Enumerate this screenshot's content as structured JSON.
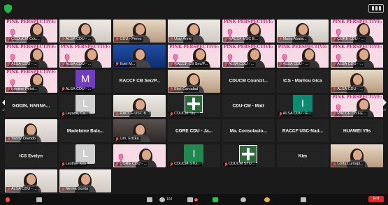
{
  "pager": {
    "left_num": "1/2",
    "right_num": "1/2"
  },
  "tiles": [
    {
      "name": "tile-ccducm-cou",
      "label": "CCDUCM Cou...",
      "kind": "pink",
      "header": "PINK PERSPECTIVE:"
    },
    {
      "name": "tile-alsa-cdu-1",
      "label": "ALSA CDU - ...",
      "kind": "cam",
      "bg": "light"
    },
    {
      "name": "tile-cdu-perez",
      "label": "CDU - Perez",
      "kind": "cam",
      "bg": "warm"
    },
    {
      "name": "tile-ujayanne",
      "label": "Ujay Anne",
      "kind": "cam",
      "bg": "light"
    },
    {
      "name": "tile-raccf-usc",
      "label": "RACCF-USC E...",
      "kind": "pink",
      "header": "PINK PERSPECTIVE:"
    },
    {
      "name": "tile-maria-abata",
      "label": "Maria Abata...",
      "kind": "cam",
      "bg": "light"
    },
    {
      "name": "tile-core-cdu-1",
      "label": "CORE CDU - ...",
      "kind": "pink",
      "header": "PINK PERSPECTIVE:"
    },
    {
      "name": "tile-alsa-cdu-2",
      "label": "ALSA CDU - ...",
      "kind": "pink",
      "header": "PINK PERSPECTIVE:"
    },
    {
      "name": "tile-alsa-cdu-3",
      "label": "ALSA CDU - ...",
      "kind": "pink",
      "header": "PINK PERSPECTIVE:"
    },
    {
      "name": "tile-edel-m",
      "label": "Edel M...",
      "kind": "cam",
      "bg": "blue"
    },
    {
      "name": "tile-raccf-cb-sec-p",
      "label": "RACCF CB Sec/P...",
      "kind": "pink",
      "header": "PINK PERSPECTIVE:"
    },
    {
      "name": "tile-alsa-cdu-4",
      "label": "ALSA CDU - ...",
      "kind": "pink",
      "header": "PINK PERSPECTIVE:"
    },
    {
      "name": "tile-alsa-cdu-5",
      "label": "ALSA CDU - ...",
      "kind": "pink",
      "header": "PINK PERSPECTIVE:"
    },
    {
      "name": "tile-alsa-cdu-6",
      "label": "ALSA CDU - ...",
      "kind": "pink",
      "header": "PINK PERSPECTIVE:"
    },
    {
      "name": "tile-kristine-pelot",
      "label": "Kristine Pelot...",
      "kind": "pink",
      "header": "PINK PERSPECTIVE:"
    },
    {
      "name": "tile-alsa-cdu-7",
      "label": "ALSA CDU - ...",
      "kind": "avatar",
      "letter": "M",
      "av": "av-purple"
    },
    {
      "name": "tile-raccf-cb-sec-p-2",
      "center": "RACCF CB Sec/P...",
      "kind": "name"
    },
    {
      "name": "tile-eliel-carcabal",
      "label": "Eliel Carcabal",
      "kind": "cam",
      "bg": "warm"
    },
    {
      "name": "tile-cducm-council",
      "center": "CDUCM Council...",
      "kind": "name"
    },
    {
      "name": "tile-ics-marilou",
      "center": "ICS - Marilou Gica",
      "kind": "name"
    },
    {
      "name": "tile-alsa-cdu-8",
      "label": "ALSA CDU - ...",
      "kind": "cam",
      "bg": "warm"
    },
    {
      "name": "tile-godin-hanna",
      "center": "GODIN, HANNA...",
      "kind": "name"
    },
    {
      "name": "tile-leyada-ca",
      "label": "Leyada, Ca...",
      "kind": "avatar",
      "letter": "L",
      "av": "av-grey"
    },
    {
      "name": "tile-raccf-usc-b",
      "label": "RACCF-USC B...",
      "kind": "cam",
      "bg": "light"
    },
    {
      "name": "tile-cducm-stu-1",
      "label": "CDUCM Stu...",
      "kind": "logo"
    },
    {
      "name": "tile-cdu-cm-matt",
      "center": "CDU-CM - Matt",
      "kind": "name"
    },
    {
      "name": "tile-alsa-cdu-9",
      "label": "ALSA CDU - E...",
      "kind": "avatar",
      "letter": "I",
      "av": "av-teal"
    },
    {
      "name": "tile-raccf-cb-fe",
      "label": "RACCF CB FE...",
      "kind": "pink",
      "header": "PINK PERSPECTIVE:"
    },
    {
      "name": "tile-yanny-orendo",
      "label": "Yanny Orendo",
      "kind": "cam",
      "bg": "light"
    },
    {
      "name": "tile-madelaine-bala",
      "center": "Madelaine Bala...",
      "kind": "name"
    },
    {
      "name": "tile-lim-ericka",
      "label": "Lim, Ericka",
      "kind": "cam",
      "bg": "dark"
    },
    {
      "name": "tile-core-cdu-ja",
      "center": "CORE CDU - Ja...",
      "kind": "name"
    },
    {
      "name": "tile-ma-consolacion",
      "center": "Ma. Consolacio...",
      "kind": "name"
    },
    {
      "name": "tile-raccf-usc-nad",
      "center": "RACCF USC-Nad...",
      "kind": "name"
    },
    {
      "name": "tile-huawei-y9s",
      "center": "HUAWEI Y9s",
      "kind": "name"
    },
    {
      "name": "tile-ics-evelyn",
      "center": "ICS Evelyn",
      "kind": "name"
    },
    {
      "name": "tile-lesther-kim",
      "label": "Lesther Kim",
      "kind": "avatar",
      "letter": "L",
      "av": "av-grey"
    },
    {
      "name": "tile-core-cdu-2",
      "label": "CORE CDU - ...",
      "kind": "pink",
      "header": ""
    },
    {
      "name": "tile-cducm-stu-2",
      "label": "CDUCM STU...",
      "kind": "avatar",
      "letter": "I",
      "av": "av-green"
    },
    {
      "name": "tile-cducm-stu-3",
      "label": "CDUCM STU...",
      "kind": "logo"
    },
    {
      "name": "tile-kim",
      "center": "Kim",
      "kind": "name"
    },
    {
      "name": "tile-lolita-lumapi",
      "label": "Lolita Lumapi...",
      "kind": "cam",
      "bg": "warm"
    },
    {
      "name": "tile-alsa-cdu-10",
      "label": "ALSA CDU - ...",
      "kind": "cam",
      "bg": "light"
    },
    {
      "name": "tile-nemia-gorita",
      "label": "Nemia Gorita",
      "kind": "cam",
      "bg": "light"
    }
  ],
  "toolbar": {
    "participants_count": "104",
    "chat_badge": "2",
    "end_label": "End"
  }
}
